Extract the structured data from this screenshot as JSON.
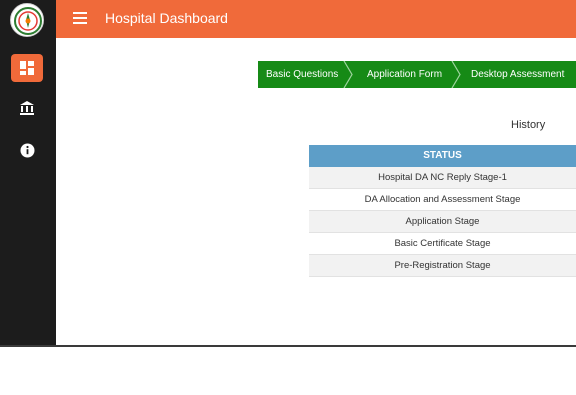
{
  "header": {
    "title": "Hospital Dashboard",
    "menu_icon": "hamburger-menu-icon"
  },
  "sidebar": {
    "items": [
      {
        "name": "dashboard",
        "icon": "dashboard-icon",
        "active": true
      },
      {
        "name": "institution",
        "icon": "bank-icon",
        "active": false
      },
      {
        "name": "info",
        "icon": "info-icon",
        "active": false
      }
    ]
  },
  "stepper": {
    "steps": [
      "Basic Questions",
      "Application Form",
      "Desktop Assessment"
    ]
  },
  "history_link": "History",
  "status_table": {
    "header": "STATUS",
    "rows": [
      "Hospital DA NC Reply Stage-1",
      "DA Allocation and Assessment Stage",
      "Application Stage",
      "Basic Certificate Stage",
      "Pre-Registration Stage"
    ]
  },
  "colors": {
    "accent": "#f06a3a",
    "sidebar": "#1c1c1c",
    "stepper": "#168a16",
    "table_header": "#5d9ec8"
  }
}
